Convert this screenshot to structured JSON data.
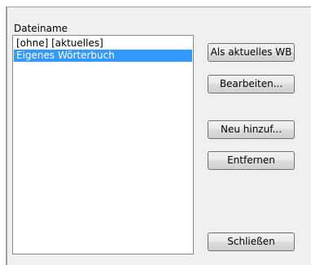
{
  "dialog": {
    "list_label": "Dateiname",
    "list_items": [
      {
        "label": "[ohne] [aktuelles]",
        "selected": false
      },
      {
        "label": "Eigenes Wörterbuch",
        "selected": true
      }
    ],
    "buttons": {
      "set_current": "Als aktuelles WB",
      "edit": "Bearbeiten...",
      "add_new": "Neu hinzuf...",
      "remove": "Entfernen",
      "close": "Schließen"
    },
    "colors": {
      "selection": "#3399ff",
      "background": "#f0f0f0"
    }
  }
}
